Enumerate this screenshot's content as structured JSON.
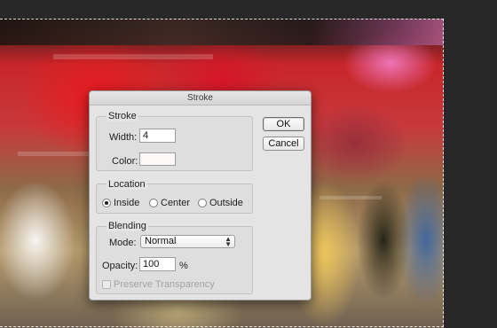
{
  "dialog": {
    "title": "Stroke",
    "buttons": {
      "ok": "OK",
      "cancel": "Cancel"
    },
    "stroke": {
      "label": "Stroke",
      "width_label": "Width:",
      "width_value": "4",
      "color_label": "Color:",
      "color_value": "#fdf7f7"
    },
    "location": {
      "label": "Location",
      "options": [
        "Inside",
        "Center",
        "Outside"
      ],
      "selected": "Inside"
    },
    "blending": {
      "label": "Blending",
      "mode_label": "Mode:",
      "mode_value": "Normal",
      "opacity_label": "Opacity:",
      "opacity_value": "100",
      "opacity_unit": "%",
      "preserve_label": "Preserve Transparency",
      "preserve_checked": false,
      "preserve_enabled": false
    }
  },
  "colors": {
    "workspace_bg": "#282828",
    "dialog_bg": "#e4e4e4"
  }
}
